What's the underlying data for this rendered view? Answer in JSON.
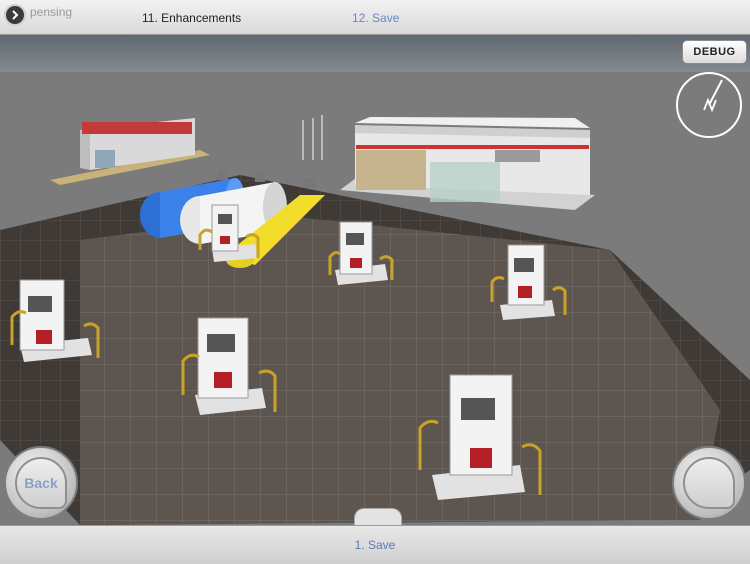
{
  "topbar": {
    "prev_step": "pensing",
    "current_step": "11. Enhancements",
    "next_step": "12. Save"
  },
  "bottombar": {
    "label": "1. Save"
  },
  "debug": {
    "label": "DEBUG"
  },
  "back": {
    "label": "Back"
  },
  "colors": {
    "link": "#6a86c9",
    "ground": "#5d5650",
    "pump_red": "#b51f26",
    "bollard": "#c9a227"
  }
}
